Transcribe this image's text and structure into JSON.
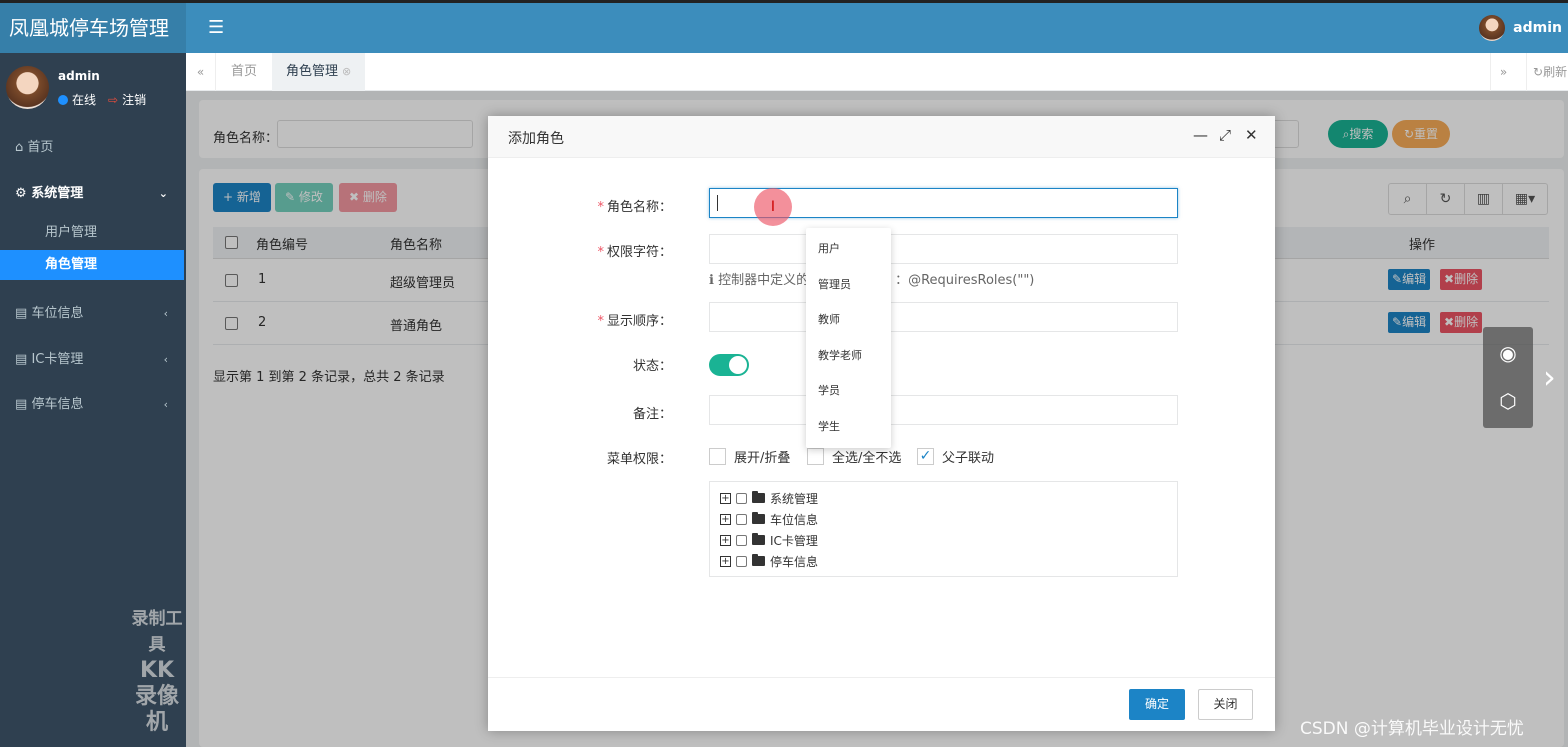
{
  "app": {
    "brand": "凤凰城停车场管理",
    "menu_icon": "menu-icon",
    "user_name": "admin"
  },
  "sidebar": {
    "user": {
      "name": "admin",
      "status": "在线",
      "logout": "注销"
    },
    "items": [
      {
        "label": "首页",
        "icon": "home-icon"
      },
      {
        "label": "系统管理",
        "icon": "gear-icon",
        "open": true,
        "children": [
          {
            "label": "用户管理"
          },
          {
            "label": "角色管理",
            "active": true
          }
        ]
      },
      {
        "label": "车位信息",
        "icon": "book-icon"
      },
      {
        "label": "IC卡管理",
        "icon": "book-icon"
      },
      {
        "label": "停车信息",
        "icon": "book-icon"
      }
    ],
    "watermark": {
      "line1": "录制工具",
      "line2": "KK 录像机"
    }
  },
  "tabs": {
    "items": [
      {
        "label": "首页"
      },
      {
        "label": "角色管理",
        "active": true
      }
    ],
    "refresh": "刷新"
  },
  "search": {
    "role_name_label": "角色名称：",
    "search_btn": "搜索",
    "reset_btn": "重置"
  },
  "toolbar": {
    "add": "新增",
    "edit": "修改",
    "delete": "删除"
  },
  "table": {
    "columns": [
      "角色编号",
      "角色名称",
      "操作"
    ],
    "rows": [
      {
        "id": "1",
        "name": "超级管理员"
      },
      {
        "id": "2",
        "name": "普通角色"
      }
    ],
    "row_edit": "编辑",
    "row_delete": "删除",
    "page_info": "显示第 1 到第 2 条记录，总共 2 条记录"
  },
  "modal": {
    "title": "添加角色",
    "fields": {
      "role_name": "角色名称：",
      "perm_key": "权限字符：",
      "perm_hint_a": "控制器中定义的",
      "perm_hint_b": "：@RequiresRoles(\"\")",
      "order": "显示顺序：",
      "status": "状态：",
      "remark": "备注：",
      "menu_perm": "菜单权限："
    },
    "menu_options": {
      "expand": "展开/折叠",
      "select_all": "全选/全不选",
      "linkage": "父子联动"
    },
    "tree": [
      "系统管理",
      "车位信息",
      "IC卡管理",
      "停车信息"
    ],
    "ok": "确定",
    "close": "关闭"
  },
  "autocomplete": [
    "用户",
    "管理员",
    "教师",
    "教学老师",
    "学员",
    "学生"
  ],
  "overlay_watermark": "CSDN @计算机毕业设计无忧",
  "colors": {
    "header": "#3c8dbc",
    "sidebar": "#2f4050",
    "primary": "#1c84c6",
    "success": "#1ab394",
    "danger": "#ed5565",
    "warning": "#f8ac59"
  }
}
